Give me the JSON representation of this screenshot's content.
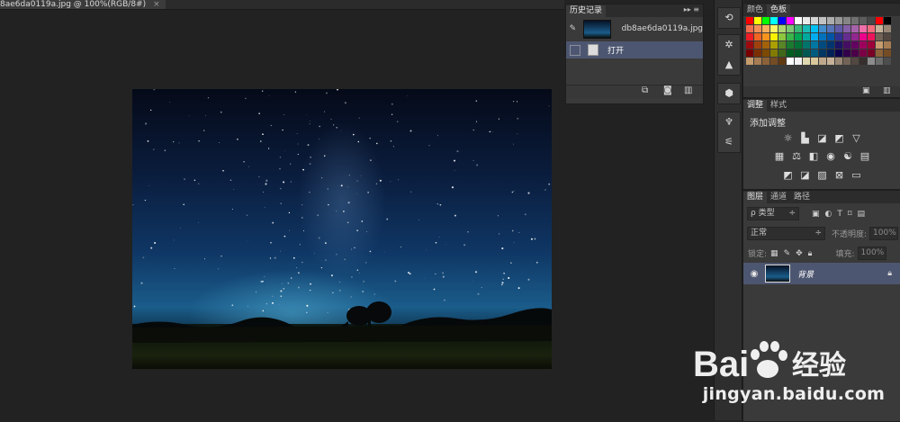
{
  "document": {
    "tab_title": "8ae6da0119a.jpg @ 100%(RGB/8#)",
    "close_glyph": "×"
  },
  "history": {
    "tabs": [
      "历史记录"
    ],
    "menu_glyph": "▸▸ ≡",
    "snapshot_name": "db8ae6da0119a.jpg",
    "items": [
      {
        "label": "打开",
        "selected": true
      }
    ],
    "footer_icons": [
      "new-document-from-state-icon",
      "camera-icon",
      "trash-icon"
    ]
  },
  "swatches": {
    "tabs": [
      "颜色",
      "色板"
    ],
    "rows": [
      [
        "#ff0000",
        "#ffff00",
        "#00ff00",
        "#00ffff",
        "#0000ff",
        "#ff00ff",
        "#ffffff",
        "#ebebeb",
        "#d6d6d6",
        "#c2c2c2",
        "#adadad",
        "#999999",
        "#858585",
        "#707070",
        "#5c5c5c",
        "#474747",
        "#ff0000",
        "#000000"
      ],
      [
        "#f26c4f",
        "#f68e55",
        "#fbaf5c",
        "#fff467",
        "#acd372",
        "#7cc576",
        "#3bb878",
        "#1abbb4",
        "#00bff3",
        "#438ccb",
        "#5574b9",
        "#605ca8",
        "#855fa8",
        "#a763a9",
        "#f06ea9",
        "#f26d7d",
        "#c7b299",
        "#998675"
      ],
      [
        "#ee1c24",
        "#f16522",
        "#f7941d",
        "#fff200",
        "#8dc63f",
        "#39b54a",
        "#00a651",
        "#00a99d",
        "#00aeef",
        "#0072bc",
        "#0054a5",
        "#2e3192",
        "#662d91",
        "#92278f",
        "#ec008c",
        "#ed145b",
        "#736357",
        "#534741"
      ],
      [
        "#9d0a0e",
        "#a0410d",
        "#a3620a",
        "#aba000",
        "#598527",
        "#1a7b30",
        "#007236",
        "#00746b",
        "#0076a3",
        "#004a80",
        "#003471",
        "#1b1464",
        "#440e62",
        "#630460",
        "#9e005d",
        "#9e0039",
        "#c69c6e",
        "#a67c52"
      ],
      [
        "#790000",
        "#7b2e00",
        "#7d4900",
        "#827b00",
        "#406618",
        "#005e20",
        "#005826",
        "#005952",
        "#005b7f",
        "#003663",
        "#002157",
        "#0d004c",
        "#32004b",
        "#4b0049",
        "#7b0046",
        "#7a0026",
        "#8c6239",
        "#754c24"
      ],
      [
        "#c69c6e",
        "#a67c52",
        "#8c6239",
        "#754c24",
        "#603913",
        "#ffffff",
        "#f2f2f2",
        "#e0d8b0",
        "#d8c89c",
        "#bfa98c",
        "#c7b299",
        "#998675",
        "#736357",
        "#534741",
        "#362f2d",
        "#8c8c8c",
        "#6d6d6d",
        "#4d4d4d"
      ]
    ],
    "footer_icons": [
      "new-swatch-icon",
      "trash-icon"
    ]
  },
  "adjustments": {
    "tabs": [
      "调整",
      "样式"
    ],
    "title": "添加调整",
    "row1": [
      "brightness-icon",
      "levels-icon",
      "curves-icon",
      "exposure-icon",
      "triangle-icon"
    ],
    "row2": [
      "vibrance-icon",
      "balance-icon",
      "bw-icon",
      "camera-filter-icon",
      "mixer-icon",
      "grid-icon"
    ],
    "row3": [
      "invert-icon",
      "posterize-icon",
      "threshold-icon",
      "selective-icon",
      "gradient-map-icon"
    ]
  },
  "layers": {
    "tabs": [
      "图层",
      "通道",
      "路径"
    ],
    "filter_label": "ρ 类型",
    "filter_icons": [
      "image-icon",
      "adjust-icon",
      "text-icon",
      "shape-icon",
      "smart-icon"
    ],
    "blend_mode": "正常",
    "opacity_label": "不透明度:",
    "opacity_value": "100%",
    "lock_label": "锁定:",
    "lock_icons": [
      "lock-pixels-icon",
      "brush-icon",
      "move-icon",
      "lock-all-icon"
    ],
    "fill_label": "填充:",
    "fill_value": "100%",
    "layer_name": "背景"
  },
  "toolbar": {
    "group1": [
      "history-brush-icon"
    ],
    "group2": [
      "sparkle-icon",
      "histogram-icon"
    ],
    "group3": [
      "cube-icon",
      "cube-rotate-icon"
    ],
    "group4": [
      "brushes-icon",
      "sliders-icon"
    ]
  },
  "watermark": {
    "brand_latin": "Bai",
    "brand_cn": "经验",
    "url": "jingyan.baidu.com"
  }
}
